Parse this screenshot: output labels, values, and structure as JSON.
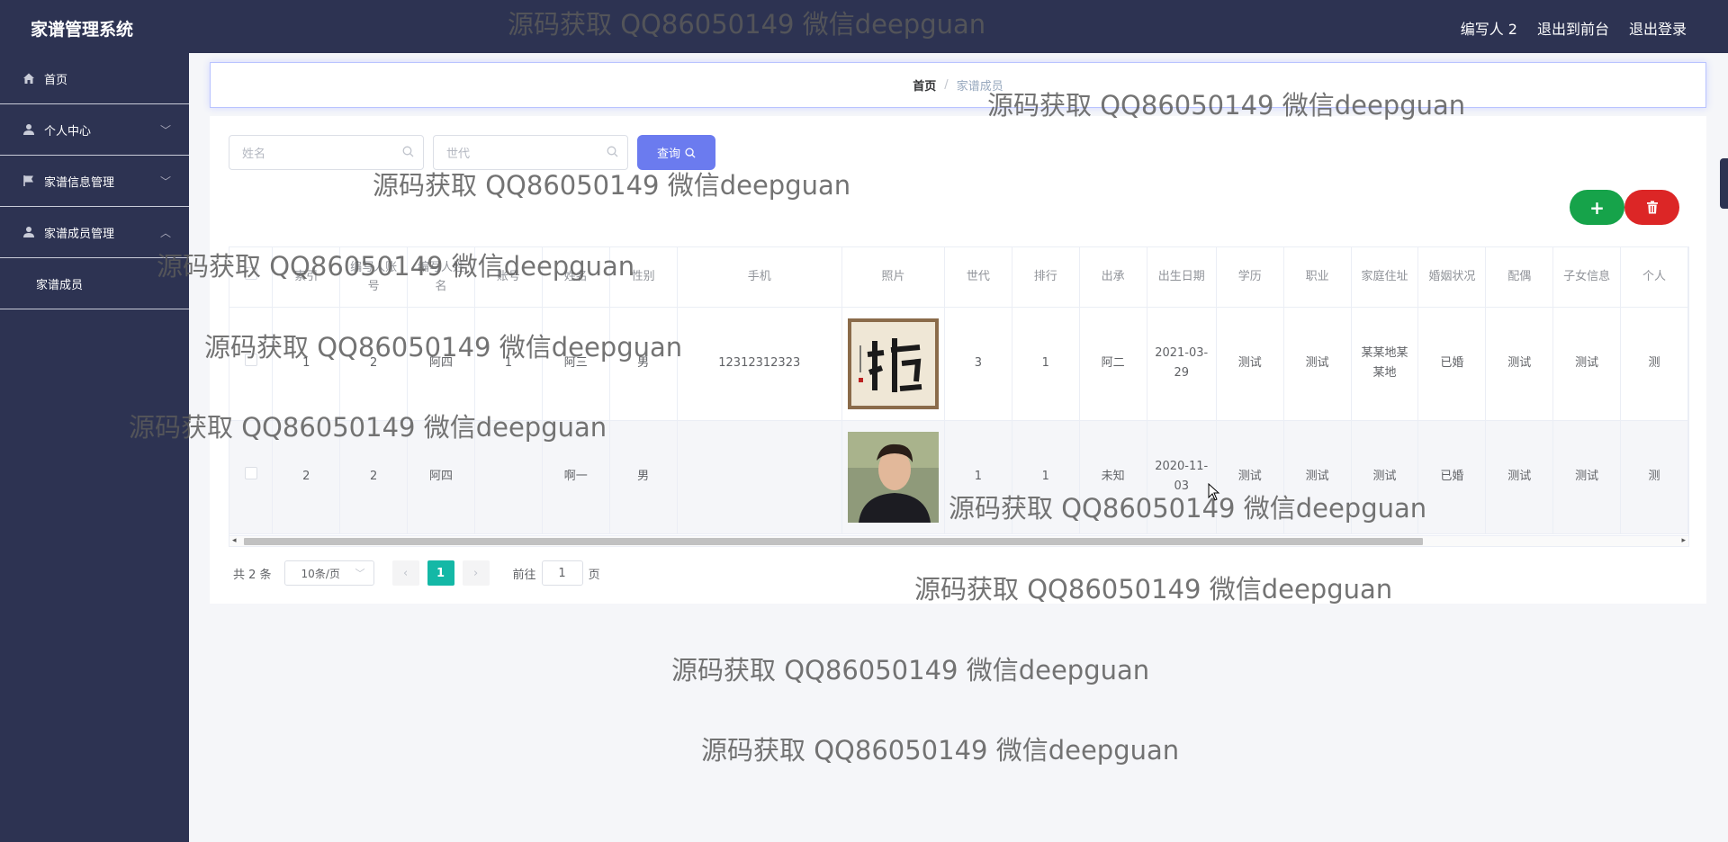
{
  "header": {
    "title": "家谱管理系统",
    "actions": [
      "编写人 2",
      "退出到前台",
      "退出登录"
    ]
  },
  "sidebar": {
    "items": [
      {
        "label": "首页",
        "icon": "home-icon"
      },
      {
        "label": "个人中心",
        "icon": "user-icon",
        "arrow": "﹀"
      },
      {
        "label": "家谱信息管理",
        "icon": "flag-icon",
        "arrow": "﹀"
      },
      {
        "label": "家谱成员管理",
        "icon": "user-icon",
        "arrow": "︿"
      }
    ],
    "sub_items": [
      {
        "label": "家谱成员"
      }
    ]
  },
  "breadcrumb": {
    "home": "首页",
    "separator": "/",
    "current": "家谱成员"
  },
  "search": {
    "name_placeholder": "姓名",
    "generation_placeholder": "世代",
    "query_label": "查询"
  },
  "toolbar": {
    "add_label": "+",
    "delete_label": "🗑"
  },
  "table": {
    "headers": [
      "索引",
      "编写人账号",
      "编写人姓名",
      "账号",
      "姓名",
      "性别",
      "手机",
      "照片",
      "世代",
      "排行",
      "出承",
      "出生日期",
      "学历",
      "职业",
      "家庭住址",
      "婚姻状况",
      "配偶",
      "子女信息",
      "个人"
    ],
    "rows": [
      {
        "cells": [
          "1",
          "2",
          "阿四",
          "1",
          "阿三",
          "男",
          "12312312323",
          "",
          "3",
          "1",
          "阿二",
          "2021-03-29",
          "测试",
          "测试",
          "某某地某某地",
          "已婚",
          "测试",
          "测试",
          "测"
        ],
        "photo": "calligraphy"
      },
      {
        "cells": [
          "2",
          "2",
          "阿四",
          "",
          "啊一",
          "男",
          "",
          "",
          "1",
          "1",
          "未知",
          "2020-11-03",
          "测试",
          "测试",
          "测试",
          "已婚",
          "测试",
          "测试",
          "测"
        ],
        "photo": "portrait"
      }
    ]
  },
  "pagination": {
    "total": "共 2 条",
    "page_size": "10条/页",
    "prev": "‹",
    "current_page": "1",
    "next": "›",
    "goto_prefix": "前往",
    "goto_value": "1",
    "goto_suffix": "页"
  },
  "watermark_text": "源码获取 QQ86050149 微信deepguan",
  "colors": {
    "sidebar_bg": "#2d3352",
    "primary": "#6b7bef",
    "add": "#16a34a",
    "delete": "#dc2626",
    "page_active": "#14b8a6"
  }
}
